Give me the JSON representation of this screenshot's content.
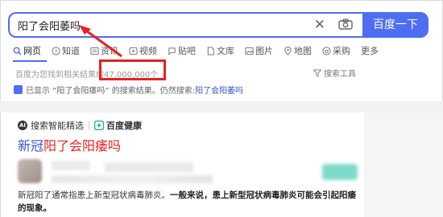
{
  "search": {
    "query": "阳了会阳萎吗",
    "button_label": "百度一下"
  },
  "tabs": [
    {
      "label": "网页",
      "icon": "search-icon",
      "active": true
    },
    {
      "label": "知道",
      "icon": "question-icon"
    },
    {
      "label": "资讯",
      "icon": "news-icon"
    },
    {
      "label": "视频",
      "icon": "video-icon"
    },
    {
      "label": "贴吧",
      "icon": "tieba-icon"
    },
    {
      "label": "文库",
      "icon": "document-icon"
    },
    {
      "label": "图片",
      "icon": "image-icon"
    },
    {
      "label": "地图",
      "icon": "map-icon"
    },
    {
      "label": "采购",
      "icon": "shopping-icon"
    },
    {
      "label": "更多",
      "icon": ""
    }
  ],
  "result_count": "百度为您找到相关结果约47,000,000个",
  "tools_label": "搜索工具",
  "correction": {
    "prefix": "已显示 “阳了会阳痿吗” 的搜索结果。仍然搜索: ",
    "link": "阳了会阳萎吗"
  },
  "card": {
    "brand1": "搜索智能精选",
    "brand2": "百度健康",
    "title_prefix": "新冠",
    "title_highlight": "阳了会阳痿吗",
    "snippet_normal": "新冠阳了通常指患上新型冠状病毒肺炎。",
    "snippet_bold": "一般来说，患上新型冠状病毒肺炎可能会引起阳痿的现象。"
  },
  "colors": {
    "accent": "#4e6ef2",
    "annotation": "#e52222",
    "link": "#3a54c8"
  }
}
